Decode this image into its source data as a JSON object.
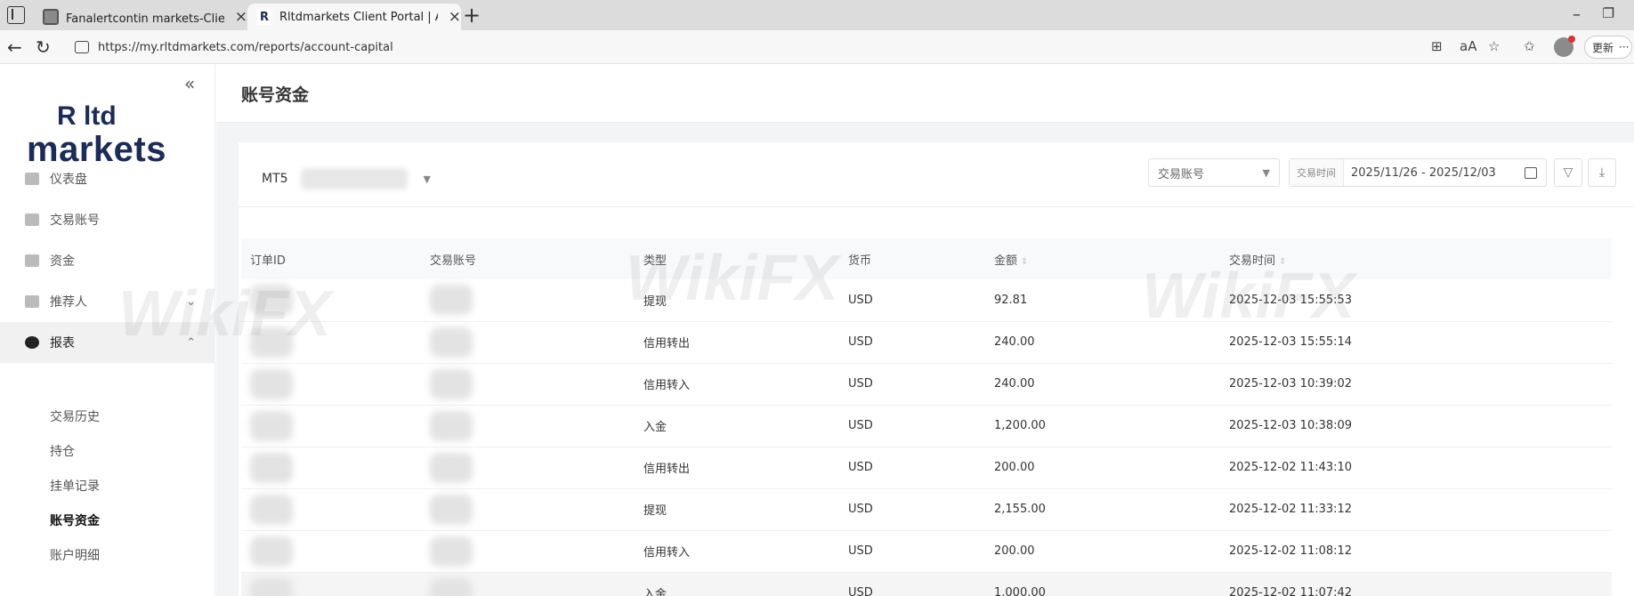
{
  "browser": {
    "tabs": [
      {
        "title": "Fanalertcontin markets-Client 登"
      },
      {
        "title": "Rltdmarkets Client Portal | Accou"
      }
    ],
    "url": "https://my.rltdmarkets.com/reports/account-capital",
    "update_label": "更新"
  },
  "sidebar": {
    "logo_top": "R ltd",
    "logo_bottom": "markets",
    "items": [
      {
        "label": "仪表盘"
      },
      {
        "label": "交易账号"
      },
      {
        "label": "资金"
      },
      {
        "label": "推荐人"
      },
      {
        "label": "报表"
      }
    ],
    "sub_items": [
      {
        "label": "交易历史"
      },
      {
        "label": "持仓"
      },
      {
        "label": "挂单记录"
      },
      {
        "label": "账号资金"
      },
      {
        "label": "账户明细"
      }
    ]
  },
  "main": {
    "title": "账号资金",
    "account_prefix": "MT5",
    "filter_placeholder": "交易账号",
    "date_label": "交易时间",
    "date_range": "2025/11/26 - 2025/12/03"
  },
  "table": {
    "headers": [
      "订单ID",
      "交易账号",
      "类型",
      "货币",
      "金额",
      "交易时间"
    ],
    "rows": [
      {
        "type": "提现",
        "currency": "USD",
        "amount": "92.81",
        "time": "2025-12-03 15:55:53"
      },
      {
        "type": "信用转出",
        "currency": "USD",
        "amount": "240.00",
        "time": "2025-12-03 15:55:14"
      },
      {
        "type": "信用转入",
        "currency": "USD",
        "amount": "240.00",
        "time": "2025-12-03 10:39:02"
      },
      {
        "type": "入金",
        "currency": "USD",
        "amount": "1,200.00",
        "time": "2025-12-03 10:38:09"
      },
      {
        "type": "信用转出",
        "currency": "USD",
        "amount": "200.00",
        "time": "2025-12-02 11:43:10"
      },
      {
        "type": "提现",
        "currency": "USD",
        "amount": "2,155.00",
        "time": "2025-12-02 11:33:12"
      },
      {
        "type": "信用转入",
        "currency": "USD",
        "amount": "200.00",
        "time": "2025-12-02 11:08:12"
      },
      {
        "type": "入金",
        "currency": "USD",
        "amount": "1,000.00",
        "time": "2025-12-02 11:07:42"
      }
    ]
  },
  "colors": {
    "negative": "#d0473d",
    "positive": "#3e9b44",
    "brand": "#1b2b5a"
  },
  "watermark": "WikiFX"
}
